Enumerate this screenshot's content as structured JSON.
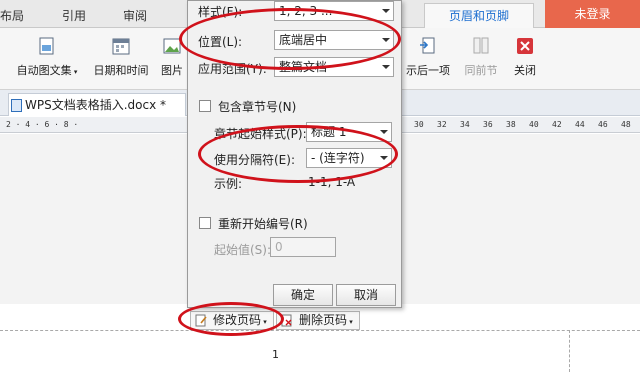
{
  "ribbon_tabs": {
    "layout": "布局",
    "references": "引用",
    "review": "审阅",
    "header_footer": "页眉和页脚",
    "login": "未登录"
  },
  "ribbon_buttons": {
    "auto_picture": "自动图文集",
    "date_time": "日期和时间",
    "picture": "图片",
    "show_next": "示后一项",
    "same_as_previous": "同前节",
    "close": "关闭"
  },
  "doc_tab": {
    "title": "WPS文档表格插入.docx *"
  },
  "ruler": {
    "left_ticks": "2 · 4 · 6 · 8 · ",
    "right_ticks": [
      "30",
      "32",
      "34",
      "36",
      "38",
      "40",
      "42",
      "44",
      "46",
      "48"
    ]
  },
  "dialog": {
    "style_label": "样式(F):",
    "style_value": "1, 2, 3 ...",
    "position_label": "位置(L):",
    "position_value": "底端居中",
    "scope_label": "应用范围(Y):",
    "scope_value": "整篇文档",
    "include_chapter_label": "包含章节号(N)",
    "chapter_style_label": "章节起始样式(P):",
    "chapter_style_value": "标题 1",
    "separator_label": "使用分隔符(E):",
    "separator_value": "-   (连字符)",
    "example_label": "示例:",
    "example_value": "1-1, 1-A",
    "restart_label": "重新开始编号(R)",
    "start_value_label": "起始值(S):",
    "start_value": "0",
    "ok": "确定",
    "cancel": "取消"
  },
  "page_buttons": {
    "modify_page_number": "修改页码",
    "delete_page_number": "删除页码"
  },
  "page_number": "1",
  "colors": {
    "accent": "#1e6fd0",
    "login_bg": "#e8674c",
    "annotation_red": "#d0121b"
  }
}
